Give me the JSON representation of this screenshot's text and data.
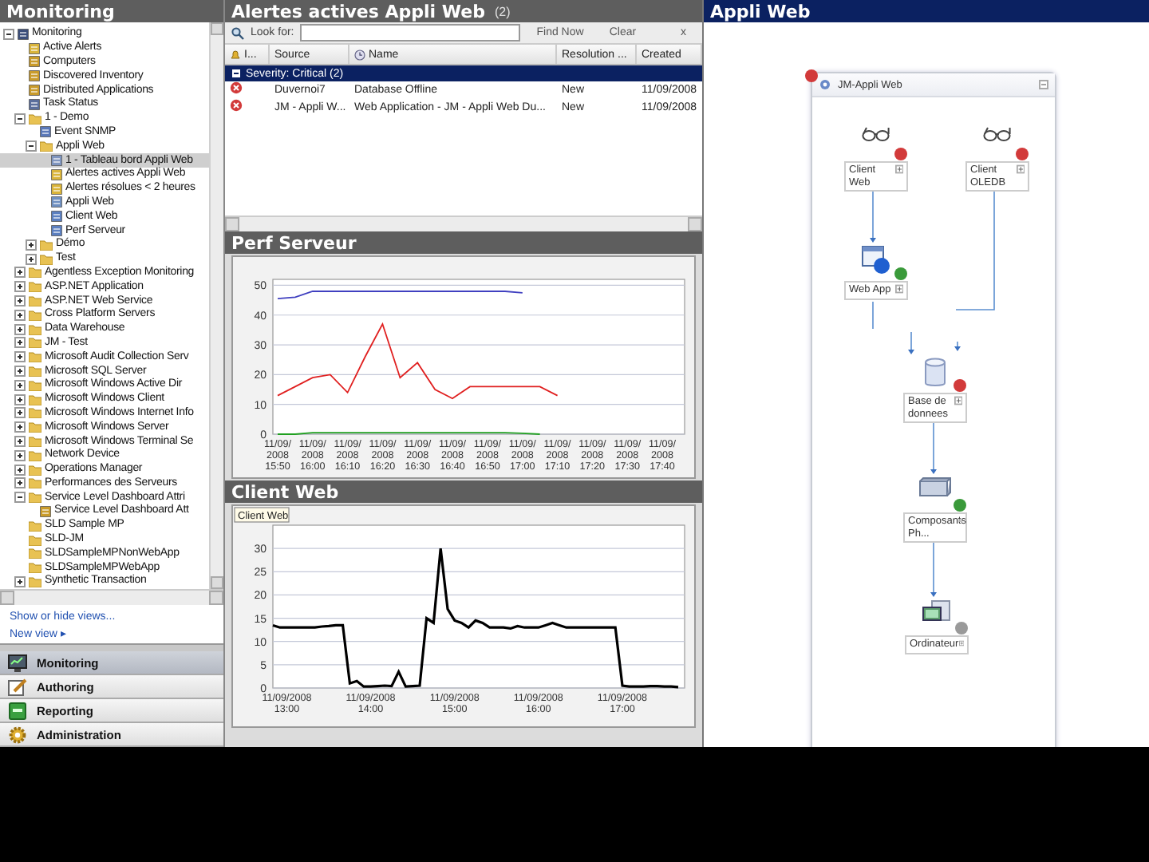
{
  "navigation_pane": {
    "title": "Monitoring",
    "tree": [
      {
        "label": "Monitoring",
        "kind": "root",
        "expanded": true,
        "selected": false,
        "children": [
          {
            "label": "Active Alerts",
            "kind": "alerts",
            "selected": false
          },
          {
            "label": "Computers",
            "kind": "state",
            "selected": false
          },
          {
            "label": "Discovered Inventory",
            "kind": "state",
            "selected": false
          },
          {
            "label": "Distributed Applications",
            "kind": "state",
            "selected": false
          },
          {
            "label": "Task Status",
            "kind": "task",
            "selected": false
          },
          {
            "label": "1 - Demo",
            "kind": "folder",
            "expanded": true,
            "selected": false,
            "children": [
              {
                "label": "Event SNMP",
                "kind": "event",
                "selected": false
              },
              {
                "label": "Appli Web",
                "kind": "folder",
                "expanded": true,
                "selected": false,
                "children": [
                  {
                    "label": "1 - Tableau bord Appli Web",
                    "kind": "dashboard",
                    "selected": true
                  },
                  {
                    "label": "Alertes actives Appli Web",
                    "kind": "alerts",
                    "selected": false
                  },
                  {
                    "label": "Alertes résolues < 2 heures",
                    "kind": "alerts",
                    "selected": false
                  },
                  {
                    "label": "Appli Web",
                    "kind": "diagram",
                    "selected": false
                  },
                  {
                    "label": "Client Web",
                    "kind": "perf",
                    "selected": false
                  },
                  {
                    "label": "Perf Serveur",
                    "kind": "perf",
                    "selected": false
                  }
                ]
              },
              {
                "label": "Démo",
                "kind": "folder",
                "expanded": false,
                "selected": false
              },
              {
                "label": "Test",
                "kind": "folder",
                "expanded": false,
                "selected": false
              }
            ]
          },
          {
            "label": "Agentless Exception Monitoring",
            "kind": "folder",
            "expanded": false,
            "selected": false
          },
          {
            "label": "ASP.NET Application",
            "kind": "folder",
            "expanded": false,
            "selected": false
          },
          {
            "label": "ASP.NET Web Service",
            "kind": "folder",
            "expanded": false,
            "selected": false
          },
          {
            "label": "Cross Platform Servers",
            "kind": "folder",
            "expanded": false,
            "selected": false
          },
          {
            "label": "Data Warehouse",
            "kind": "folder",
            "expanded": false,
            "selected": false
          },
          {
            "label": "JM - Test",
            "kind": "folder",
            "expanded": false,
            "selected": false
          },
          {
            "label": "Microsoft Audit Collection Serv",
            "kind": "folder",
            "expanded": false,
            "selected": false
          },
          {
            "label": "Microsoft SQL Server",
            "kind": "folder",
            "expanded": false,
            "selected": false
          },
          {
            "label": "Microsoft Windows Active Dir",
            "kind": "folder",
            "expanded": false,
            "selected": false
          },
          {
            "label": "Microsoft Windows Client",
            "kind": "folder",
            "expanded": false,
            "selected": false
          },
          {
            "label": "Microsoft Windows Internet Info",
            "kind": "folder",
            "expanded": false,
            "selected": false
          },
          {
            "label": "Microsoft Windows Server",
            "kind": "folder",
            "expanded": false,
            "selected": false
          },
          {
            "label": "Microsoft Windows Terminal Se",
            "kind": "folder",
            "expanded": false,
            "selected": false
          },
          {
            "label": "Network Device",
            "kind": "folder",
            "expanded": false,
            "selected": false
          },
          {
            "label": "Operations Manager",
            "kind": "folder",
            "expanded": false,
            "selected": false
          },
          {
            "label": "Performances des Serveurs",
            "kind": "folder",
            "expanded": false,
            "selected": false
          },
          {
            "label": "Service Level Dashboard Attri",
            "kind": "folder",
            "expanded": true,
            "selected": false,
            "children": [
              {
                "label": "Service Level Dashboard Att",
                "kind": "state",
                "selected": false
              }
            ]
          },
          {
            "label": "SLD Sample MP",
            "kind": "folder",
            "selected": false
          },
          {
            "label": "SLD-JM",
            "kind": "folder",
            "selected": false
          },
          {
            "label": "SLDSampleMPNonWebApp",
            "kind": "folder",
            "selected": false
          },
          {
            "label": "SLDSampleMPWebApp",
            "kind": "folder",
            "selected": false
          },
          {
            "label": "Synthetic Transaction",
            "kind": "folder",
            "expanded": false,
            "selected": false
          }
        ]
      }
    ],
    "links": [
      "Show or hide views...",
      "New view ▸"
    ],
    "sections": [
      {
        "label": "Monitoring",
        "selected": true
      },
      {
        "label": "Authoring",
        "selected": false
      },
      {
        "label": "Reporting",
        "selected": false
      },
      {
        "label": "Administration",
        "selected": false
      }
    ]
  },
  "alerts_panel": {
    "title": "Alertes actives Appli Web",
    "count": "(2)",
    "search": {
      "label": "Look for:",
      "buttons": [
        "Find Now",
        "Clear"
      ],
      "close": "x"
    },
    "columns": [
      "I...",
      "Source",
      "Name",
      "Resolution ...",
      "Created"
    ],
    "group": {
      "label": "Severity: Critical (2)",
      "expanded": true
    },
    "rows": [
      {
        "source": "Duvernoi7",
        "name": "Database Offline",
        "resolution": "New",
        "created": "11/09/2008"
      },
      {
        "source": "JM - Appli W...",
        "name": "Web Application - JM - Appli Web Du...",
        "resolution": "New",
        "created": "11/09/2008"
      }
    ]
  },
  "perf_panel": {
    "title": "Perf Serveur",
    "chart_data": {
      "type": "line",
      "grid": true,
      "ylim": [
        0,
        52
      ],
      "yticks": [
        0,
        10,
        20,
        30,
        40,
        50
      ],
      "categories": [
        "11/09/ 2008 15:50",
        null,
        "11/09/ 2008 16:00",
        null,
        "11/09/ 2008 16:10",
        null,
        "11/09/ 2008 16:20",
        null,
        "11/09/ 2008 16:30",
        null,
        "11/09/ 2008 16:40",
        null,
        "11/09/ 2008 16:50",
        null,
        "11/09/ 2008 17:00",
        null,
        "11/09/ 2008 17:10",
        null,
        "11/09/ 2008 17:20",
        null,
        "11/09/ 2008 17:30",
        null,
        "11/09/ 2008 17:40"
      ],
      "series": [
        {
          "color": "#4040c0",
          "values": [
            45.5,
            46,
            48,
            48,
            48,
            48,
            48,
            48,
            48,
            48,
            48,
            48,
            48,
            48,
            47.5,
            null,
            null,
            null,
            null,
            null,
            null,
            null,
            null
          ]
        },
        {
          "color": "#e02020",
          "values": [
            13,
            16,
            19,
            20,
            14,
            26,
            37,
            19,
            24,
            15,
            12,
            16,
            16,
            16,
            16,
            16,
            13,
            null,
            null,
            null,
            null,
            null,
            null
          ]
        },
        {
          "color": "#20a020",
          "values": [
            0,
            0,
            0.5,
            0.5,
            0.5,
            0.5,
            0.5,
            0.5,
            0.5,
            0.5,
            0.5,
            0.5,
            0.5,
            0.5,
            0.3,
            0,
            null,
            null,
            null,
            null,
            null,
            null,
            null
          ]
        }
      ]
    }
  },
  "client_web_panel": {
    "title": "Client Web",
    "chart_data": {
      "type": "line",
      "grid": true,
      "ylim": [
        0,
        35
      ],
      "yticks": [
        0,
        5,
        10,
        15,
        20,
        25,
        30
      ],
      "categories": [
        null,
        null,
        "11/09/2008 13:00",
        null,
        null,
        null,
        null,
        null,
        null,
        null,
        null,
        null,
        null,
        null,
        "11/09/2008 14:00",
        null,
        null,
        null,
        null,
        null,
        null,
        null,
        null,
        null,
        null,
        null,
        "11/09/2008 15:00",
        null,
        null,
        null,
        null,
        null,
        null,
        null,
        null,
        null,
        null,
        null,
        "11/09/2008 16:00",
        null,
        null,
        null,
        null,
        null,
        null,
        null,
        null,
        null,
        null,
        null,
        "11/09/2008 17:00",
        null,
        null,
        null,
        null,
        null,
        null,
        null,
        null
      ],
      "series": [
        {
          "name": "Client Web",
          "color": "#000000",
          "values": [
            13.5,
            13,
            13,
            13,
            13,
            13,
            13,
            13.2,
            13.3,
            13.5,
            13.5,
            1,
            1.5,
            0.3,
            0.3,
            0.4,
            0.5,
            0.4,
            3.5,
            0.3,
            0.4,
            0.5,
            15,
            14,
            30,
            17,
            14.5,
            14,
            13,
            14.5,
            14,
            13,
            13,
            13,
            12.8,
            13.3,
            13,
            13,
            13,
            13.5,
            14,
            13.5,
            13,
            13,
            13,
            13,
            13,
            13,
            13,
            13,
            0.5,
            0.3,
            0.3,
            0.3,
            0.4,
            0.4,
            0.3,
            0.3,
            0.2
          ]
        }
      ]
    }
  },
  "diagram_panel": {
    "title": "Appli Web",
    "group": {
      "title": "JM-Appli Web",
      "color": "#d23a3a"
    },
    "nodes": [
      {
        "label": "Client Web",
        "kind": "client",
        "color": "#d23a3a"
      },
      {
        "label": "Client OLEDB",
        "kind": "client",
        "color": "#d23a3a"
      },
      {
        "label": "Web App",
        "kind": "webapp",
        "color": "#3a9a3a"
      },
      {
        "label": "Base de donnees",
        "kind": "database",
        "color": "#d23a3a"
      },
      {
        "label": "Composants Ph...",
        "kind": "component",
        "color": "#3a9a3a"
      },
      {
        "label": "Ordinateur",
        "kind": "computer",
        "color": "#9a9a9a"
      }
    ]
  }
}
